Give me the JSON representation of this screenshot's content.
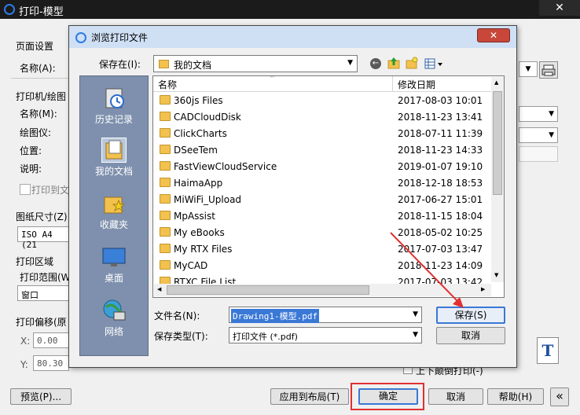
{
  "outer": {
    "title": "打印-模型",
    "page_setup_label": "页面设置",
    "name_label": "名称(A):",
    "printer_group": "打印机/绘图",
    "printer_name_label": "名称(M):",
    "plotter_label": "绘图仪:",
    "location_label": "位置:",
    "description_label": "说明:",
    "print_to_file_label": "打印到文",
    "paper_size_label": "图纸尺寸(Z)",
    "paper_size_value": "ISO A4 (21",
    "print_area_label": "打印区域",
    "print_range_label": "打印范围(W)",
    "print_range_value": "窗口",
    "print_offset_label": "打印偏移(原",
    "offset_x_label": "X:",
    "offset_x_value": "0.00",
    "offset_y_label": "Y:",
    "offset_y_value": "80.30",
    "upside_down_label": "上下颠倒打印(-)",
    "preview_button": "预览(P)...",
    "apply_layout_button": "应用到布局(T)",
    "ok_button": "确定",
    "cancel_button": "取消",
    "help_button": "帮助(H)",
    "collapse_button": "«"
  },
  "dialog": {
    "title": "浏览打印文件",
    "save_in_label": "保存在(I):",
    "save_in_value": "我的文档",
    "places": [
      {
        "label": "历史记录",
        "icon": "history-icon"
      },
      {
        "label": "我的文档",
        "icon": "my-documents-icon"
      },
      {
        "label": "收藏夹",
        "icon": "favorites-icon"
      },
      {
        "label": "桌面",
        "icon": "desktop-icon"
      },
      {
        "label": "网络",
        "icon": "network-icon"
      }
    ],
    "columns": {
      "name": "名称",
      "modified": "修改日期"
    },
    "files": [
      {
        "name": "360js Files",
        "date": "2017-08-03 10:01"
      },
      {
        "name": "CADCloudDisk",
        "date": "2018-11-23 13:41"
      },
      {
        "name": "ClickCharts",
        "date": "2018-07-11 11:39"
      },
      {
        "name": "DSeeTem",
        "date": "2018-11-23 14:33"
      },
      {
        "name": "FastViewCloudService",
        "date": "2019-01-07 19:10"
      },
      {
        "name": "HaimaApp",
        "date": "2018-12-18 18:53"
      },
      {
        "name": "MiWiFi_Upload",
        "date": "2017-06-27 15:01"
      },
      {
        "name": "MpAssist",
        "date": "2018-11-15 18:04"
      },
      {
        "name": "My eBooks",
        "date": "2018-05-02 10:25"
      },
      {
        "name": "My RTX Files",
        "date": "2017-07-03 13:47"
      },
      {
        "name": "MyCAD",
        "date": "2018-11-23 14:09"
      },
      {
        "name": "RTXC File List",
        "date": "2017-07-03 13:42"
      }
    ],
    "filename_label": "文件名(N):",
    "filename_value": "Drawing1-模型.pdf",
    "filetype_label": "保存类型(T):",
    "filetype_value": "打印文件 (*.pdf)",
    "save_button": "保存(S)",
    "cancel_button": "取消"
  },
  "colors": {
    "annotation_red": "#e03030",
    "places_bar": "#7e90ad",
    "titlebar": "#1b1b1b"
  }
}
